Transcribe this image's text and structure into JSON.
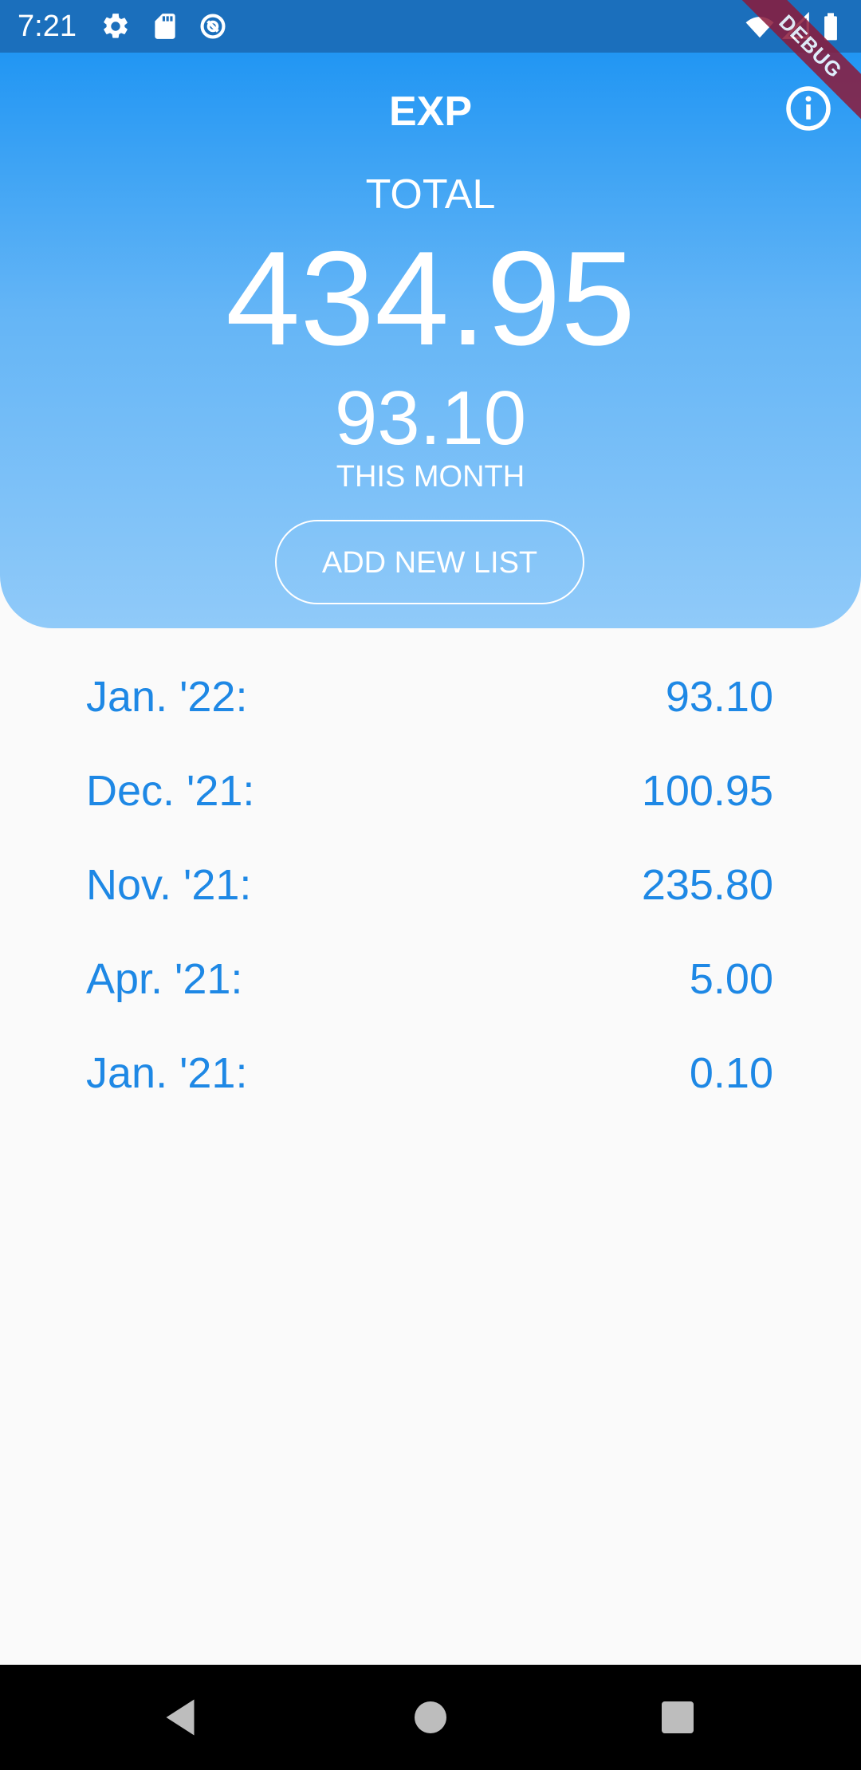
{
  "status_bar": {
    "time": "7:21",
    "icons": [
      "settings-icon",
      "sd-card-icon",
      "sync-icon",
      "wifi-icon",
      "signal-icon",
      "battery-icon"
    ]
  },
  "header": {
    "title": "EXP",
    "total_label": "TOTAL",
    "total_value": "434.95",
    "month_value": "93.10",
    "month_label": "THIS MONTH",
    "add_button_label": "ADD NEW LIST",
    "info_icon": "info-icon"
  },
  "debug_banner": "DEBUG",
  "months": [
    {
      "label": "Jan. '22:",
      "value": "93.10"
    },
    {
      "label": "Dec. '21:",
      "value": "100.95"
    },
    {
      "label": "Nov. '21:",
      "value": "235.80"
    },
    {
      "label": "Apr. '21:",
      "value": "5.00"
    },
    {
      "label": "Jan. '21:",
      "value": "0.10"
    }
  ],
  "nav_bar": {
    "icons": [
      "back-icon",
      "home-icon",
      "recents-icon"
    ]
  },
  "colors": {
    "accent": "#1e88e5",
    "header_top": "#2196f3",
    "header_bottom": "#90caf9",
    "status_bar": "#1b6fbc",
    "background": "#fafafa"
  }
}
